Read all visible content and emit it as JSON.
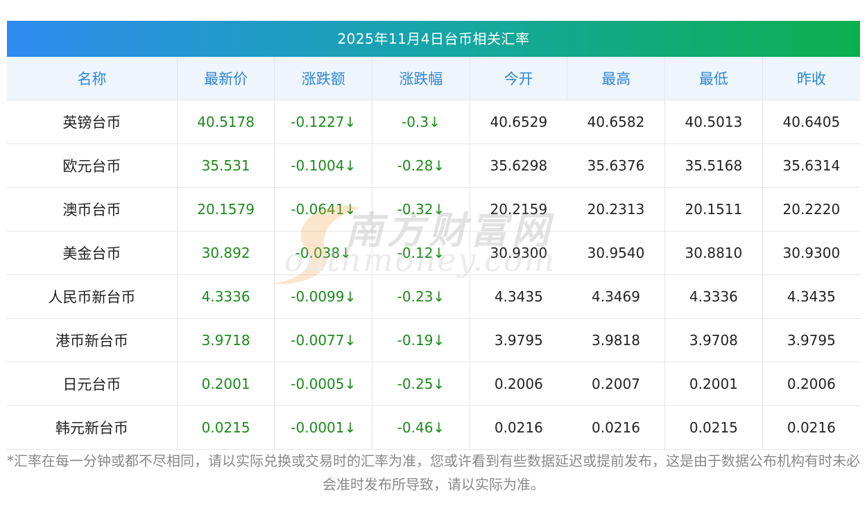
{
  "title": "2025年11月4日台币相关汇率",
  "columns": [
    "名称",
    "最新价",
    "涨跌额",
    "涨跌幅",
    "今开",
    "最高",
    "最低",
    "昨收"
  ],
  "rows": [
    {
      "name": "英镑台币",
      "latest": "40.5178",
      "change": "-0.1227↓",
      "change_pct": "-0.3↓",
      "open": "40.6529",
      "high": "40.6582",
      "low": "40.5013",
      "prev_close": "40.6405"
    },
    {
      "name": "欧元台币",
      "latest": "35.531",
      "change": "-0.1004↓",
      "change_pct": "-0.28↓",
      "open": "35.6298",
      "high": "35.6376",
      "low": "35.5168",
      "prev_close": "35.6314"
    },
    {
      "name": "澳币台币",
      "latest": "20.1579",
      "change": "-0.0641↓",
      "change_pct": "-0.32↓",
      "open": "20.2159",
      "high": "20.2313",
      "low": "20.1511",
      "prev_close": "20.2220"
    },
    {
      "name": "美金台币",
      "latest": "30.892",
      "change": "-0.038↓",
      "change_pct": "-0.12↓",
      "open": "30.9300",
      "high": "30.9540",
      "low": "30.8810",
      "prev_close": "30.9300"
    },
    {
      "name": "人民币新台币",
      "latest": "4.3336",
      "change": "-0.0099↓",
      "change_pct": "-0.23↓",
      "open": "4.3435",
      "high": "4.3469",
      "low": "4.3336",
      "prev_close": "4.3435"
    },
    {
      "name": "港币新台币",
      "latest": "3.9718",
      "change": "-0.0077↓",
      "change_pct": "-0.19↓",
      "open": "3.9795",
      "high": "3.9818",
      "low": "3.9708",
      "prev_close": "3.9795"
    },
    {
      "name": "日元台币",
      "latest": "0.2001",
      "change": "-0.0005↓",
      "change_pct": "-0.25↓",
      "open": "0.2006",
      "high": "0.2007",
      "low": "0.2001",
      "prev_close": "0.2006"
    },
    {
      "name": "韩元新台币",
      "latest": "0.0215",
      "change": "-0.0001↓",
      "change_pct": "-0.46↓",
      "open": "0.0216",
      "high": "0.0216",
      "low": "0.0215",
      "prev_close": "0.0216"
    }
  ],
  "footnote": "*汇率在每一分钟或都不尽相同，请以实际兑换或交易时的汇率为准，您或许看到有些数据延迟或提前发布，这是由于数据公布机构有时未必会准时发布所导致，请以实际为准。",
  "watermark": {
    "cn": "南方财富网",
    "en": "outhmoney.com"
  },
  "colors": {
    "title_gradient_start": "#2f8bf0",
    "title_gradient_end": "#0bb04d",
    "header_text": "#2f86d8",
    "header_bg": "#eef5fd",
    "down_green": "#1b8a1b",
    "footnote_text": "#888888"
  }
}
